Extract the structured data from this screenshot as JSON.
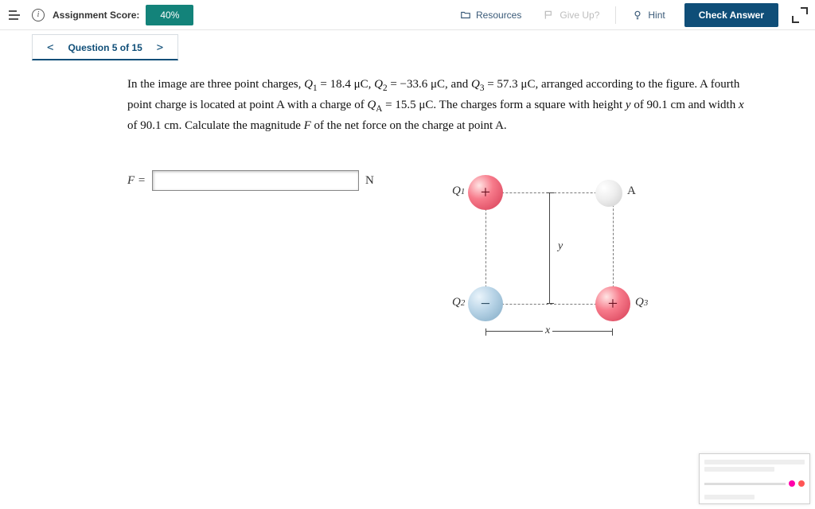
{
  "topbar": {
    "score_label": "Assignment Score:",
    "score_value": "40%",
    "resources": "Resources",
    "giveup": "Give Up?",
    "hint": "Hint",
    "check": "Check Answer"
  },
  "nav": {
    "question_label": "Question 5 of 15"
  },
  "problem": {
    "text_parts": {
      "p1a": "In the image are three point charges, ",
      "q1": "Q",
      "q1sub": "1",
      "eq1": " = 18.4 μC, ",
      "q2": "Q",
      "q2sub": "2",
      "eq2": " = −33.6 μC, and ",
      "q3": "Q",
      "q3sub": "3",
      "eq3": " = 57.3 μC, arranged according to the figure. A fourth point charge is located at point A with a charge of ",
      "qa": "Q",
      "qasub": "A",
      "eqa": " = 15.5 μC. The charges form a square with height ",
      "yvar": "y",
      "ytxt": " of 90.1 cm and width ",
      "xvar": "x",
      "xtxt": " of 90.1 cm. Calculate the magnitude ",
      "fvar": "F",
      "tail": " of the net force on the charge at point A."
    }
  },
  "answer": {
    "prefix": "F =",
    "unit": "N",
    "value": ""
  },
  "figure": {
    "labels": {
      "Q1": "Q",
      "s1": "1",
      "Q2": "Q",
      "s2": "2",
      "Q3": "Q",
      "s3": "3",
      "A": "A",
      "x": "x",
      "y": "y"
    },
    "signs": {
      "q1": "+",
      "q2": "−",
      "q3": "+"
    }
  }
}
